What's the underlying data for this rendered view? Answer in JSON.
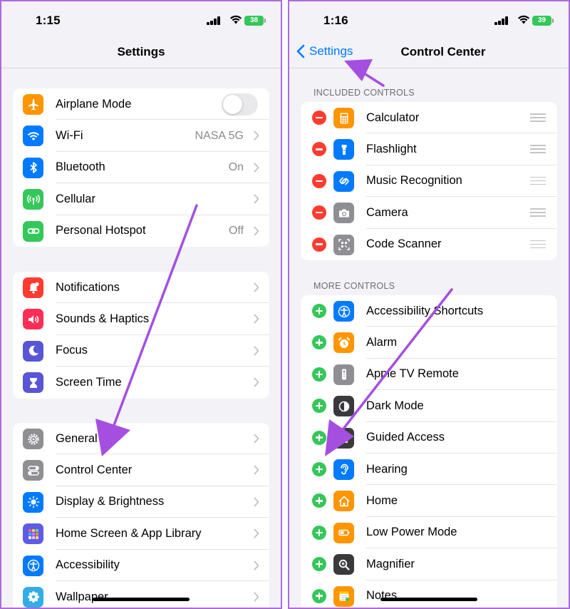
{
  "left": {
    "status": {
      "time": "1:15",
      "battery": "38"
    },
    "nav": {
      "title": "Settings"
    },
    "groups": [
      [
        {
          "label": "Airplane Mode",
          "value": "",
          "icon": "airplane-icon",
          "color": "#ff9500",
          "toggle": true
        },
        {
          "label": "Wi-Fi",
          "value": "NASA 5G",
          "icon": "wifi-icon",
          "color": "#007aff"
        },
        {
          "label": "Bluetooth",
          "value": "On",
          "icon": "bluetooth-icon",
          "color": "#007aff"
        },
        {
          "label": "Cellular",
          "value": "",
          "icon": "antenna-icon",
          "color": "#34c759"
        },
        {
          "label": "Personal Hotspot",
          "value": "Off",
          "icon": "hotspot-link-icon",
          "color": "#34c759"
        }
      ],
      [
        {
          "label": "Notifications",
          "value": "",
          "icon": "bell-icon",
          "color": "#ff3b30"
        },
        {
          "label": "Sounds & Haptics",
          "value": "",
          "icon": "speaker-icon",
          "color": "#ff2d55"
        },
        {
          "label": "Focus",
          "value": "",
          "icon": "moon-icon",
          "color": "#5856d6"
        },
        {
          "label": "Screen Time",
          "value": "",
          "icon": "hourglass-icon",
          "color": "#5856d6"
        }
      ],
      [
        {
          "label": "General",
          "value": "",
          "icon": "gear-icon",
          "color": "#8e8e93"
        },
        {
          "label": "Control Center",
          "value": "",
          "icon": "switches-icon",
          "color": "#8e8e93"
        },
        {
          "label": "Display & Brightness",
          "value": "",
          "icon": "sun-icon",
          "color": "#007aff"
        },
        {
          "label": "Home Screen & App Library",
          "value": "",
          "icon": "app-grid-icon",
          "color": "#5e5ce6"
        },
        {
          "label": "Accessibility",
          "value": "",
          "icon": "accessibility-icon",
          "color": "#007aff"
        },
        {
          "label": "Wallpaper",
          "value": "",
          "icon": "flower-icon",
          "color": "#32ade6"
        }
      ]
    ]
  },
  "right": {
    "status": {
      "time": "1:16",
      "battery": "39"
    },
    "nav": {
      "back": "Settings",
      "title": "Control Center"
    },
    "included_header": "INCLUDED CONTROLS",
    "more_header": "MORE CONTROLS",
    "included": [
      {
        "label": "Calculator",
        "icon": "calculator-icon",
        "color": "#ff9500"
      },
      {
        "label": "Flashlight",
        "icon": "flashlight-icon",
        "color": "#007aff"
      },
      {
        "label": "Music Recognition",
        "icon": "shazam-icon",
        "color": "#007aff"
      },
      {
        "label": "Camera",
        "icon": "camera-icon",
        "color": "#8e8e93"
      },
      {
        "label": "Code Scanner",
        "icon": "qr-code-icon",
        "color": "#8e8e93"
      }
    ],
    "more": [
      {
        "label": "Accessibility Shortcuts",
        "icon": "accessibility-icon",
        "color": "#007aff"
      },
      {
        "label": "Alarm",
        "icon": "alarm-clock-icon",
        "color": "#ff9500"
      },
      {
        "label": "Apple TV Remote",
        "icon": "remote-icon",
        "color": "#8e8e93"
      },
      {
        "label": "Dark Mode",
        "icon": "dark-mode-icon",
        "color": "#3a3a3c"
      },
      {
        "label": "Guided Access",
        "icon": "lock-dotted-icon",
        "color": "#3a3a3c"
      },
      {
        "label": "Hearing",
        "icon": "ear-icon",
        "color": "#007aff"
      },
      {
        "label": "Home",
        "icon": "house-icon",
        "color": "#ff9500"
      },
      {
        "label": "Low Power Mode",
        "icon": "battery-icon",
        "color": "#ff9500"
      },
      {
        "label": "Magnifier",
        "icon": "magnifier-icon",
        "color": "#3a3a3c"
      },
      {
        "label": "Notes",
        "icon": "notes-icon",
        "color": "#ff9500"
      }
    ]
  },
  "annotation_color": "#a54fe0"
}
